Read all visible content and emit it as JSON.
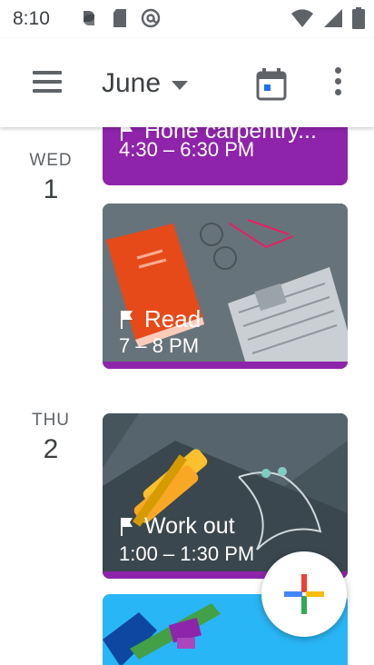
{
  "status_bar": {
    "time": "8:10",
    "icons": [
      "google-photos-icon",
      "sd-card-icon",
      "at-sign-icon",
      "wifi-icon",
      "signal-icon",
      "battery-icon"
    ]
  },
  "app_bar": {
    "month": "June",
    "menu_icon": "hamburger-menu-icon",
    "today_icon": "calendar-today-icon",
    "more_icon": "more-vertical-icon"
  },
  "colors": {
    "event_purple": "#8e24aa",
    "read_bg": "#5f6a6f",
    "workout_bg": "#3c4a52"
  },
  "days": [
    {
      "dow": "WED",
      "num": "1",
      "events": [
        {
          "title": "Hone carpentry...",
          "time": "4:30 – 6:30 PM",
          "style": "solid-purple"
        },
        {
          "title": "Read",
          "time": "7 – 8 PM",
          "style": "illustration-read"
        }
      ]
    },
    {
      "dow": "THU",
      "num": "2",
      "events": [
        {
          "title": "Work out",
          "time": "1:00 – 1:30 PM",
          "style": "illustration-workout"
        },
        {
          "title": "",
          "time": "",
          "style": "illustration-partial"
        }
      ]
    }
  ],
  "fab": {
    "icon": "plus-icon"
  }
}
